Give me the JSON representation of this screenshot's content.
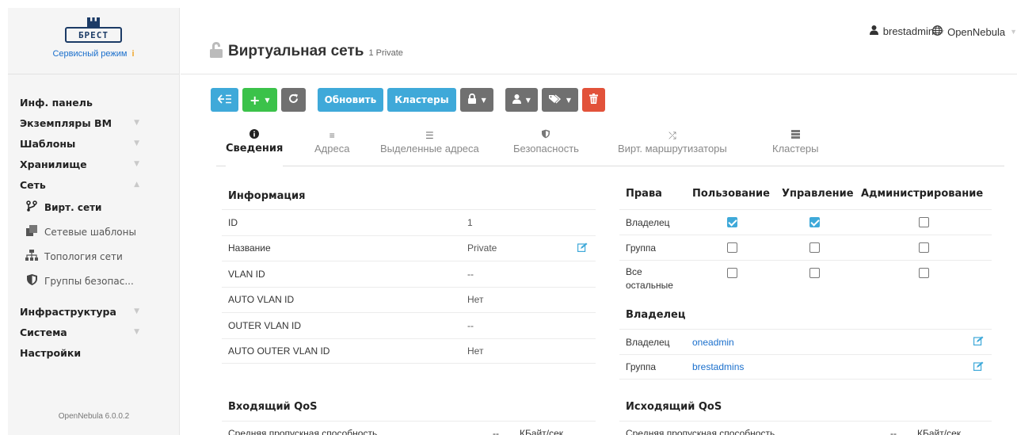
{
  "brand": {
    "logo_text": "БРЕСТ",
    "mode_label": "Сервисный режим",
    "mode_icon": "i"
  },
  "sidebar": {
    "items": [
      {
        "label": "Инф. панель"
      },
      {
        "label": "Экземпляры ВМ"
      },
      {
        "label": "Шаблоны"
      },
      {
        "label": "Хранилище"
      },
      {
        "label": "Сеть"
      }
    ],
    "network_sub": [
      {
        "label": "Вирт. сети",
        "icon": "fork-icon"
      },
      {
        "label": "Сетевые шаблоны",
        "icon": "copy-icon"
      },
      {
        "label": "Топология сети",
        "icon": "sitemap-icon"
      },
      {
        "label": "Группы безопас...",
        "icon": "shield-icon"
      }
    ],
    "lower_items": [
      {
        "label": "Инфраструктура"
      },
      {
        "label": "Система"
      },
      {
        "label": "Настройки"
      }
    ],
    "version": "OpenNebula 6.0.0.2"
  },
  "header": {
    "title": "Виртуальная сеть",
    "subtitle": "1 Private",
    "user": "brestadmin",
    "zone": "OpenNebula"
  },
  "toolbar": {
    "update_label": "Обновить",
    "clusters_label": "Кластеры"
  },
  "tabs": [
    {
      "label": "Сведения",
      "icon": "info-icon"
    },
    {
      "label": "Адреса",
      "icon": "list-icon"
    },
    {
      "label": "Выделенные адреса",
      "icon": "list-ul-icon"
    },
    {
      "label": "Безопасность",
      "icon": "shield-icon"
    },
    {
      "label": "Вирт. маршрутизаторы",
      "icon": "random-icon"
    },
    {
      "label": "Кластеры",
      "icon": "server-icon"
    }
  ],
  "info": {
    "title": "Информация",
    "rows": [
      {
        "key": "ID",
        "value": "1"
      },
      {
        "key": "Название",
        "value": "Private"
      },
      {
        "key": "VLAN ID",
        "value": "--"
      },
      {
        "key": "AUTO VLAN ID",
        "value": "Нет"
      },
      {
        "key": "OUTER VLAN ID",
        "value": "--"
      },
      {
        "key": "AUTO OUTER VLAN ID",
        "value": "Нет"
      }
    ]
  },
  "perms": {
    "headers": [
      "Права",
      "Пользование",
      "Управление",
      "Администрирование"
    ],
    "rows": [
      {
        "key": "Владелец",
        "use": true,
        "manage": true,
        "admin": false
      },
      {
        "key": "Группа",
        "use": false,
        "manage": false,
        "admin": false
      },
      {
        "key": "Все остальные",
        "use": false,
        "manage": false,
        "admin": false
      }
    ]
  },
  "owner": {
    "title": "Владелец",
    "rows": [
      {
        "key": "Владелец",
        "value": "oneadmin"
      },
      {
        "key": "Группа",
        "value": "brestadmins"
      }
    ]
  },
  "qos_in": {
    "title": "Входящий QoS",
    "row_label": "Средняя пропускная способность",
    "value": "--",
    "unit": "КБайт/сек"
  },
  "qos_out": {
    "title": "Исходящий QoS",
    "row_label": "Средняя пропускная способность",
    "value": "--",
    "unit": "КБайт/сек"
  }
}
